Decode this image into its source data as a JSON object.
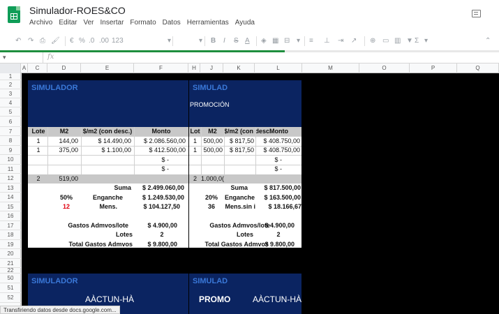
{
  "app": {
    "title": "Simulador-ROES&CO",
    "menu": [
      "Archivo",
      "Editar",
      "Ver",
      "Insertar",
      "Formato",
      "Datos",
      "Herramientas",
      "Ayuda"
    ]
  },
  "toolbar": {
    "percent": "%",
    "dec0": ".0",
    "dec00": ".00",
    "format123": "123",
    "currency": "€"
  },
  "progress": 0.57,
  "formula_bar": {
    "fx": "fx"
  },
  "columns": [
    "A",
    "C",
    "D",
    "E",
    "F",
    "H",
    "J",
    "K",
    "L",
    "M",
    "O",
    "P",
    "Q"
  ],
  "rows": [
    "1",
    "2",
    "3",
    "4",
    "5",
    "6",
    "7",
    "8",
    "9",
    "10",
    "11",
    "12",
    "13",
    "14",
    "15",
    "16",
    "17",
    "18",
    "19",
    "20",
    "21",
    "22",
    "50",
    "51",
    "52"
  ],
  "sim1": {
    "title": "SIMULADOR",
    "headers": [
      "Lote",
      "M2",
      "$/m2 (con desc.)",
      "Monto"
    ],
    "rows": [
      [
        "1",
        "144,00",
        "$ 14.490,00",
        "$ 2.086.560,00"
      ],
      [
        "1",
        "375,00",
        "$ 1.100,00",
        "$ 412.500,00"
      ],
      [
        "",
        "",
        "",
        "$ -"
      ],
      [
        "",
        "",
        "",
        "$ -"
      ]
    ],
    "total_row": [
      "2",
      "519,00",
      "",
      ""
    ],
    "suma_label": "Suma",
    "suma_value": "$ 2.499.060,00",
    "enganche_pct": "50%",
    "enganche_label": "Enganche",
    "enganche_value": "$ 1.249.530,00",
    "meses": "12",
    "meses_label": "Mens.",
    "meses_value": "$ 104.127,50",
    "gastos_label": "Gastos Admvos/lote",
    "gastos_value": "$ 4.900,00",
    "lotes_label": "Lotes",
    "lotes_value": "2",
    "total_gastos_label": "Total Gastos Admvos",
    "total_gastos_value": "$ 9.800,00"
  },
  "sim2": {
    "title": "SIMULAD",
    "subtitle": "PROMOCIÓN",
    "headers": [
      "Lot",
      "M2",
      "$/m2 (con desc.",
      "Monto"
    ],
    "rows": [
      [
        "1",
        "500,00",
        "$ 817,50",
        "$ 408.750,00"
      ],
      [
        "1",
        "500,00",
        "$ 817,50",
        "$ 408.750,00"
      ],
      [
        "",
        "",
        "",
        "$ -"
      ],
      [
        "",
        "",
        "",
        "$ -"
      ]
    ],
    "total_row": [
      "2",
      "1.000,0(",
      "",
      ""
    ],
    "suma_label": "Suma",
    "suma_value": "$ 817.500,00",
    "enganche_pct": "20%",
    "enganche_label": "Enganche",
    "enganche_value": "$ 163.500,00",
    "meses": "36",
    "meses_label": "Mens.sin i",
    "meses_value": "$ 18.166,67",
    "gastos_label": "Gastos Admvos/lote",
    "gastos_value": "$ 4.900,00",
    "lotes_label": "Lotes",
    "lotes_value": "2",
    "total_gastos_label": "Total Gastos Admvos",
    "total_gastos_value": "$ 9.800,00"
  },
  "sim3": {
    "title": "SIMULADOR",
    "subtitle": "AÀCTUN-HÀ"
  },
  "sim4": {
    "title": "SIMULAD",
    "promo": "PROMO",
    "subtitle": "AÀCTUN-HÀ"
  },
  "status": "Transfiriendo datos desde docs.google.com...",
  "colors": {
    "header_blue": "#0b2461",
    "title_blue": "#3a78d8",
    "meses_red": "#e0000f"
  }
}
